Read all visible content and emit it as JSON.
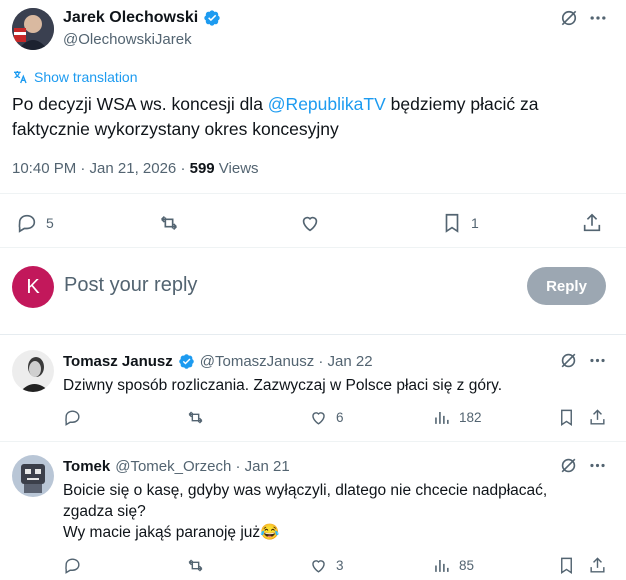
{
  "post": {
    "author_name": "Jarek Olechowski",
    "author_handle": "@OlechowskiJarek",
    "show_translation": "Show translation",
    "text_before": "Po decyzji WSA ws. koncesji dla ",
    "mention": "@RepublikaTV",
    "text_after": " będziemy płacić za faktycznie wykorzystany okres koncesyjny",
    "timestamp": "10:40 PM · Jan 21, 2026 · ",
    "views_count": "599",
    "views_label": " Views",
    "actions": {
      "replies": "5",
      "reposts": "",
      "likes": "",
      "bookmarks": "1"
    }
  },
  "reply_composer": {
    "avatar_letter": "K",
    "placeholder": "Post your reply",
    "button_label": "Reply"
  },
  "replies": [
    {
      "name": "Tomasz Janusz",
      "handle": "@TomaszJanusz · Jan 22",
      "verified": true,
      "text": "Dziwny sposób rozliczania. Zazwyczaj w Polsce płaci się z góry.",
      "replies": "",
      "reposts": "",
      "likes": "6",
      "views": "182"
    },
    {
      "name": "Tomek",
      "handle": "@Tomek_Orzech · Jan 21",
      "verified": false,
      "text_line1": "Boicie się o kasę, gdyby was wyłączyli, dlatego nie chcecie nadpłacać, zgadza się?",
      "text_line2": "Wy macie jakąś paranoję już",
      "emoji": "😂",
      "replies": "",
      "reposts": "",
      "likes": "3",
      "views": "85"
    }
  ],
  "colors": {
    "accent": "#1d9bf0",
    "composer_avatar": "#c2185b",
    "reply_button": "#8b98a5",
    "muted": "#536471"
  },
  "icons": [
    "grok-icon",
    "more-icon",
    "translate-icon",
    "reply-icon",
    "repost-icon",
    "like-icon",
    "bookmark-icon",
    "share-icon",
    "views-icon",
    "verified-icon"
  ]
}
